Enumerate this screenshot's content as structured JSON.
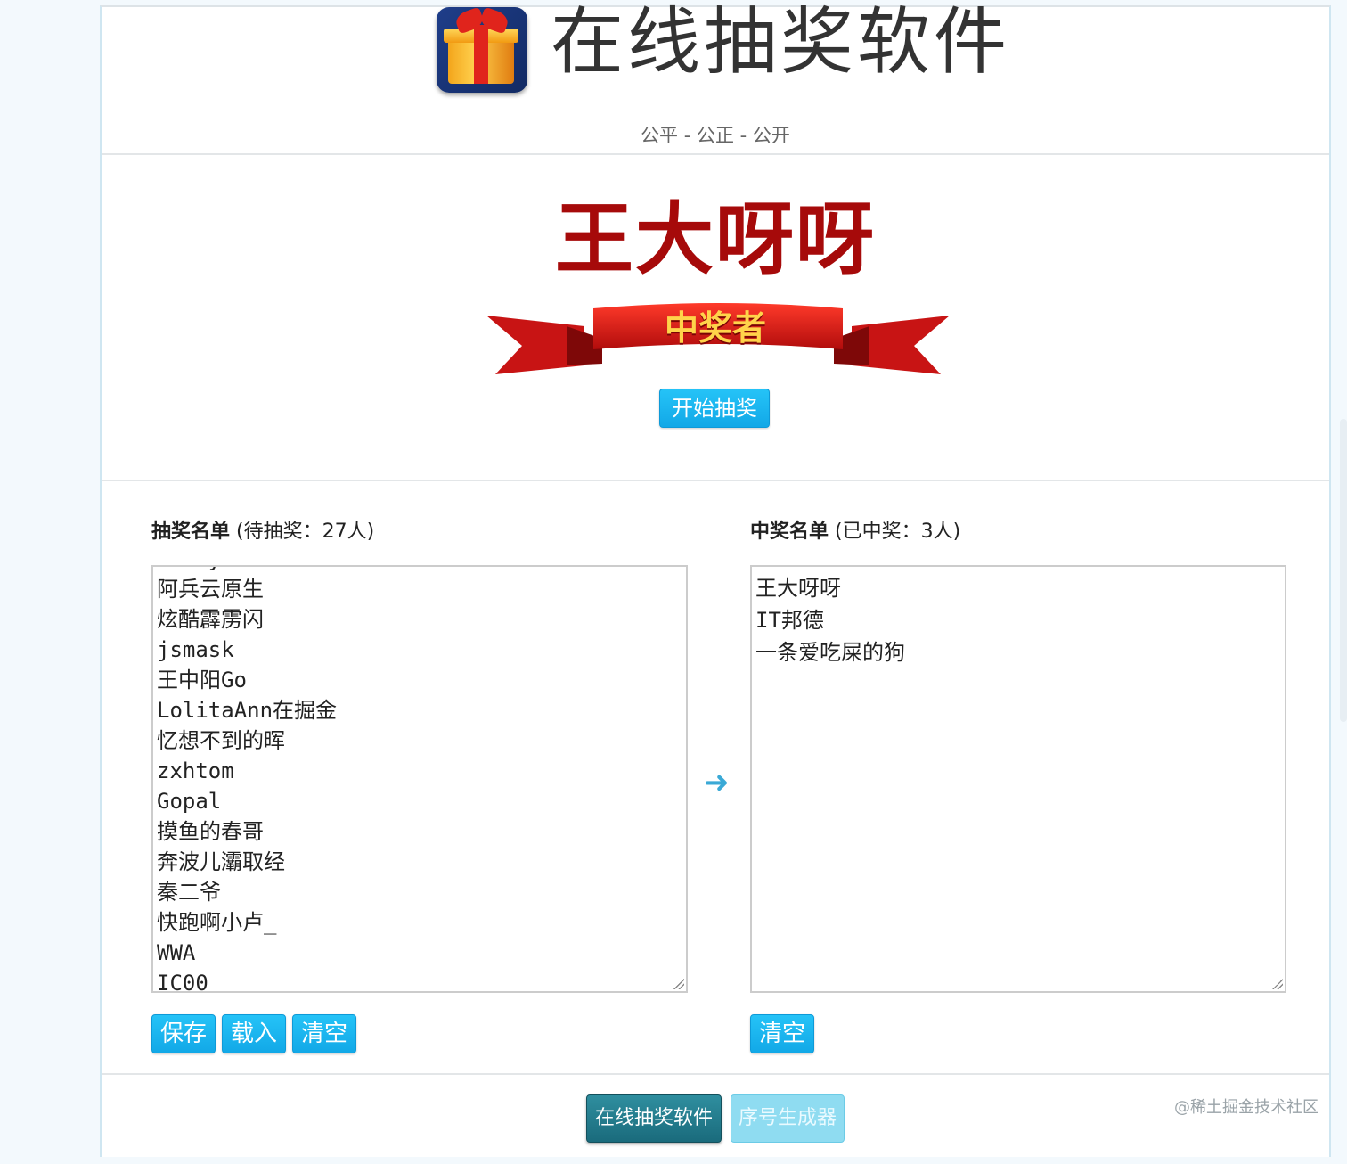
{
  "header": {
    "title": "在线抽奖软件",
    "subtitle": "公平 - 公正 - 公开"
  },
  "winner": {
    "name": "王大呀呀",
    "banner_label": "中奖者",
    "start_button": "开始抽奖"
  },
  "candidates": {
    "label_bold": "抽奖名单",
    "label_rest": "(待抽奖：27人)",
    "items": [
      "Jimmy",
      "阿兵云原生",
      "炫酷霹雳闪",
      "jsmask",
      "王中阳Go",
      "LolitaAnn在掘金",
      "忆想不到的晖",
      "zxhtom",
      "Gopal",
      "摸鱼的春哥",
      "奔波儿灞取经",
      "秦二爷",
      "快跑啊小卢_",
      "WWA",
      "IC00"
    ],
    "buttons": {
      "save": "保存",
      "load": "载入",
      "clear": "清空"
    }
  },
  "winners": {
    "label_bold": "中奖名单",
    "label_rest": "(已中奖：3人)",
    "items": [
      "王大呀呀",
      "IT邦德",
      "一条爱吃屎的狗"
    ],
    "buttons": {
      "clear": "清空"
    }
  },
  "footer": {
    "lottery_button": "在线抽奖软件",
    "serial_button": "序号生成器"
  },
  "watermark": "@稀土掘金技术社区",
  "icons": {
    "app": "gift-icon",
    "arrow": "arrow-right-icon",
    "ribbon": "ribbon-banner-icon"
  },
  "colors": {
    "accent": "#12a8e7",
    "winner_red": "#a60a0a",
    "footer_dark": "#1a6b7c"
  }
}
